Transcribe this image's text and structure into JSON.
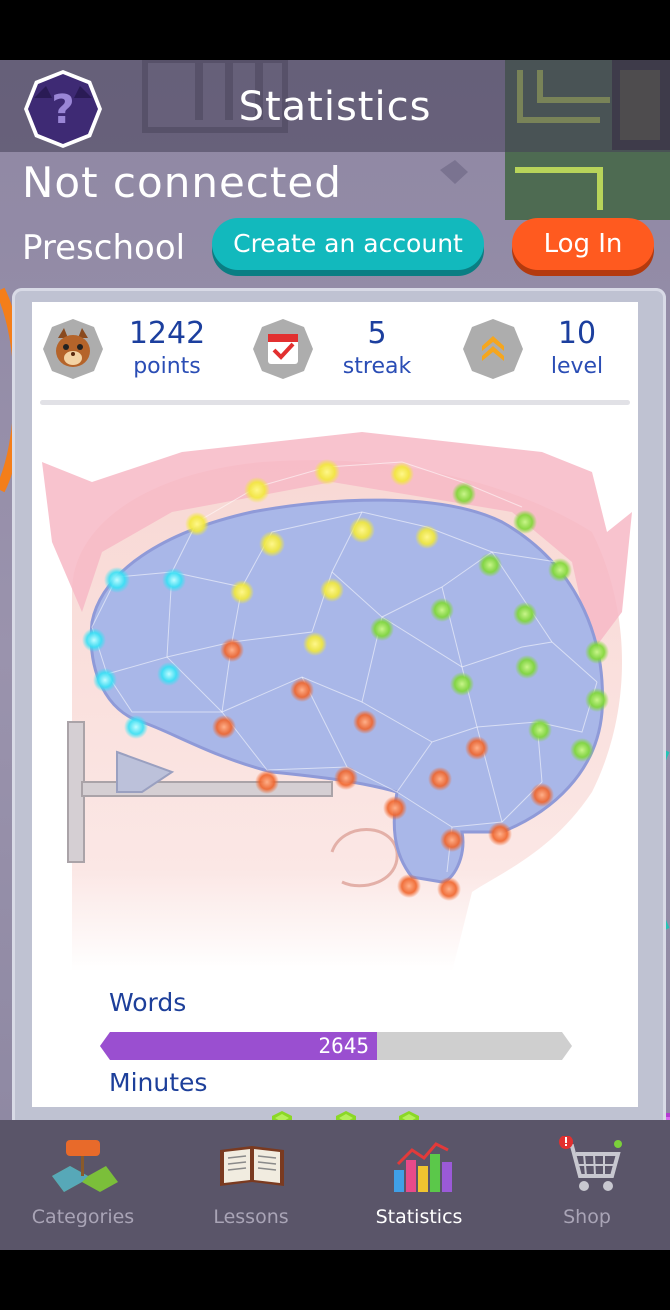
{
  "header": {
    "title": "Statistics",
    "help_icon": "question-mark-icon"
  },
  "account": {
    "status": "Not connected",
    "grade": "Preschool",
    "create_account_label": "Create an account",
    "login_label": "Log In"
  },
  "stats": {
    "points": {
      "value": "1242",
      "label": "points",
      "icon": "squirrel-icon"
    },
    "streak": {
      "value": "5",
      "label": "streak",
      "icon": "calendar-check-icon"
    },
    "level": {
      "value": "10",
      "label": "level",
      "icon": "chevron-up-icon"
    }
  },
  "progress": {
    "words_label": "Words",
    "words_value": "2645",
    "words_fill_fraction": 0.59,
    "minutes_label": "Minutes"
  },
  "pager": {
    "pages": 3,
    "active_index": 1
  },
  "tabs": [
    {
      "label": "Categories",
      "icon": "map-icon",
      "active": false
    },
    {
      "label": "Lessons",
      "icon": "book-icon",
      "active": false
    },
    {
      "label": "Statistics",
      "icon": "bar-chart-icon",
      "active": true
    },
    {
      "label": "Shop",
      "icon": "shopping-cart-icon",
      "active": false
    }
  ],
  "colors": {
    "accent_teal": "#12b9bd",
    "accent_orange": "#ff5a1f",
    "stat_blue": "#1c3f9e",
    "words_bar": "#9a4fd0",
    "brain_blue": "#a9b7e8"
  }
}
